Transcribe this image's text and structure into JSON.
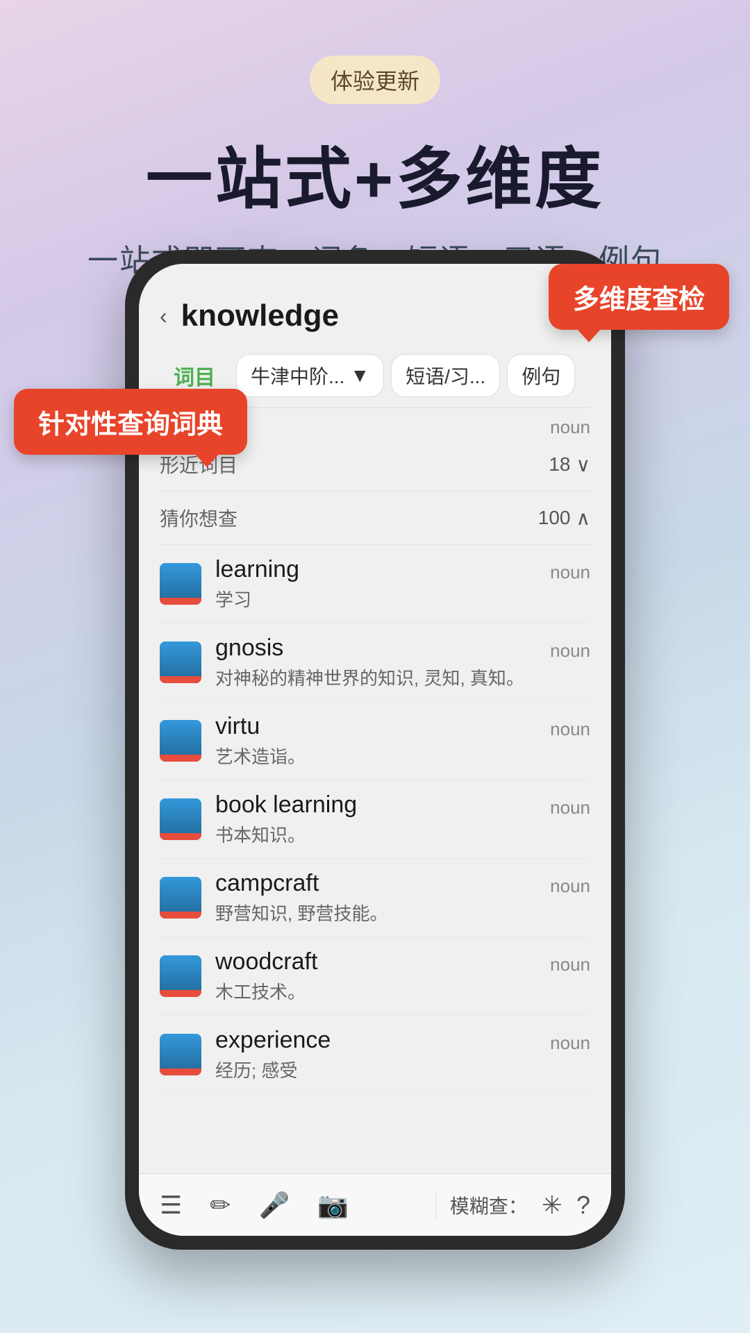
{
  "badge": "体验更新",
  "mainTitle": "一站式+多维度",
  "subtitle": "一站式即可查：词条、短语、习语、例句",
  "callouts": {
    "topRight": "多维度查检",
    "left": "针对性查询词典"
  },
  "dict": {
    "searchWord": "knowledge",
    "backArrow": "‹",
    "tabs": {
      "active": "词目",
      "dropdown": "牛津中阶...",
      "dropdownArrow": "▼",
      "tab2": "短语/习...",
      "tab3": "例句"
    },
    "sections": {
      "similar": {
        "label": "形近词目",
        "count": "18",
        "arrow": "∨"
      },
      "guess": {
        "label": "猜你想查",
        "count": "100",
        "arrow": "∧"
      }
    },
    "firstNoun": "noun",
    "words": [
      {
        "word": "learning",
        "meaning": "学习",
        "pos": "noun"
      },
      {
        "word": "gnosis",
        "meaning": "对神秘的精神世界的知识, 灵知, 真知。",
        "pos": "noun"
      },
      {
        "word": "virtu",
        "meaning": "艺术造诣。",
        "pos": "noun"
      },
      {
        "word": "book learning",
        "meaning": "书本知识。",
        "pos": "noun"
      },
      {
        "word": "campcraft",
        "meaning": "野营知识, 野营技能。",
        "pos": "noun"
      },
      {
        "word": "woodcraft",
        "meaning": "木工技术。",
        "pos": "noun"
      },
      {
        "word": "experience",
        "meaning": "经历; 感受",
        "pos": "noun"
      }
    ],
    "toolbar": {
      "icons": [
        "☰",
        "✏",
        "🎤",
        "📷"
      ],
      "fuzzyLabel": "模糊查：",
      "asterisk": "✳",
      "question": "?"
    }
  }
}
